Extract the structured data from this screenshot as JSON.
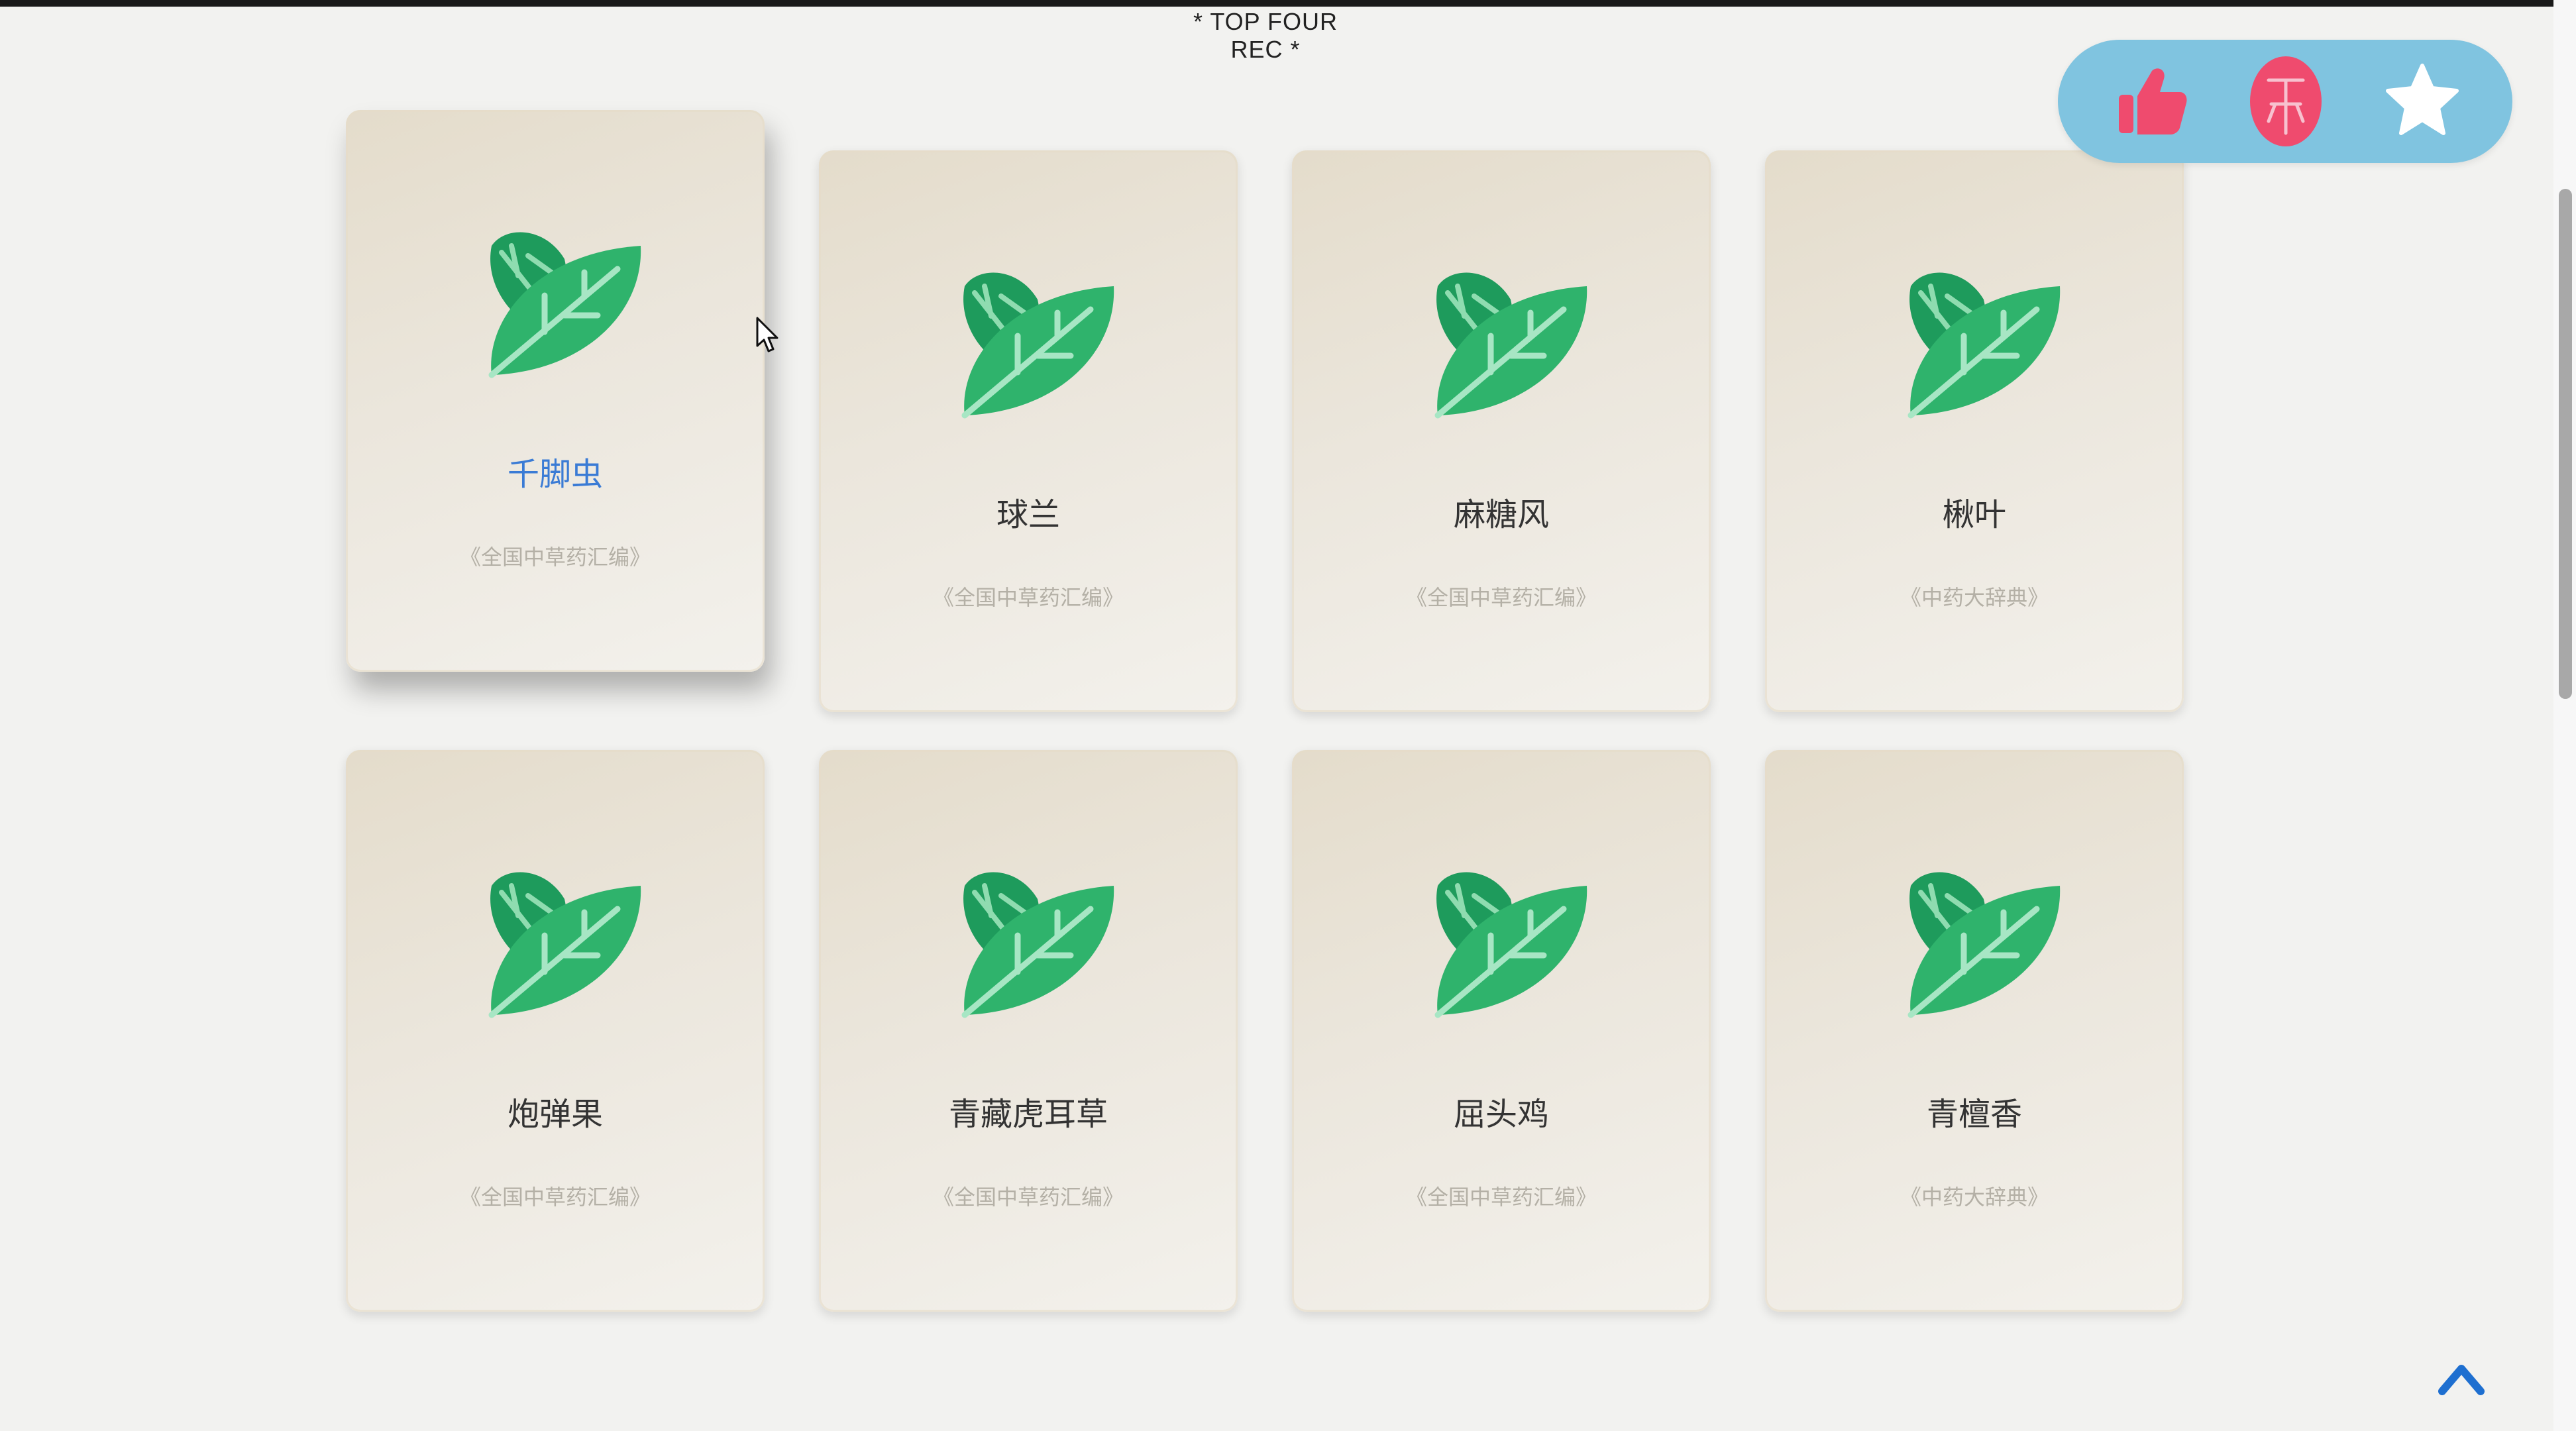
{
  "header": {
    "title": "* TOP FOUR REC *"
  },
  "cards": [
    {
      "name": "千脚虫",
      "source": "《全国中草药汇编》"
    },
    {
      "name": "球兰",
      "source": "《全国中草药汇编》"
    },
    {
      "name": "麻糖风",
      "source": "《全国中草药汇编》"
    },
    {
      "name": "楸叶",
      "source": "《中药大辞典》"
    },
    {
      "name": "炮弹果",
      "source": "《全国中草药汇编》"
    },
    {
      "name": "青藏虎耳草",
      "source": "《全国中草药汇编》"
    },
    {
      "name": "屈头鸡",
      "source": "《全国中草药汇编》"
    },
    {
      "name": "青檀香",
      "source": "《中药大辞典》"
    }
  ],
  "actions": {
    "like_icon": "thumbs-up-icon",
    "coin_icon": "coin-icon",
    "favorite_icon": "star-icon",
    "panel_color": "#80c4e0",
    "accent_color": "#ef4b6e"
  },
  "leaf_icon": "leaf-icon",
  "back_to_top_icon": "chevron-up-icon"
}
